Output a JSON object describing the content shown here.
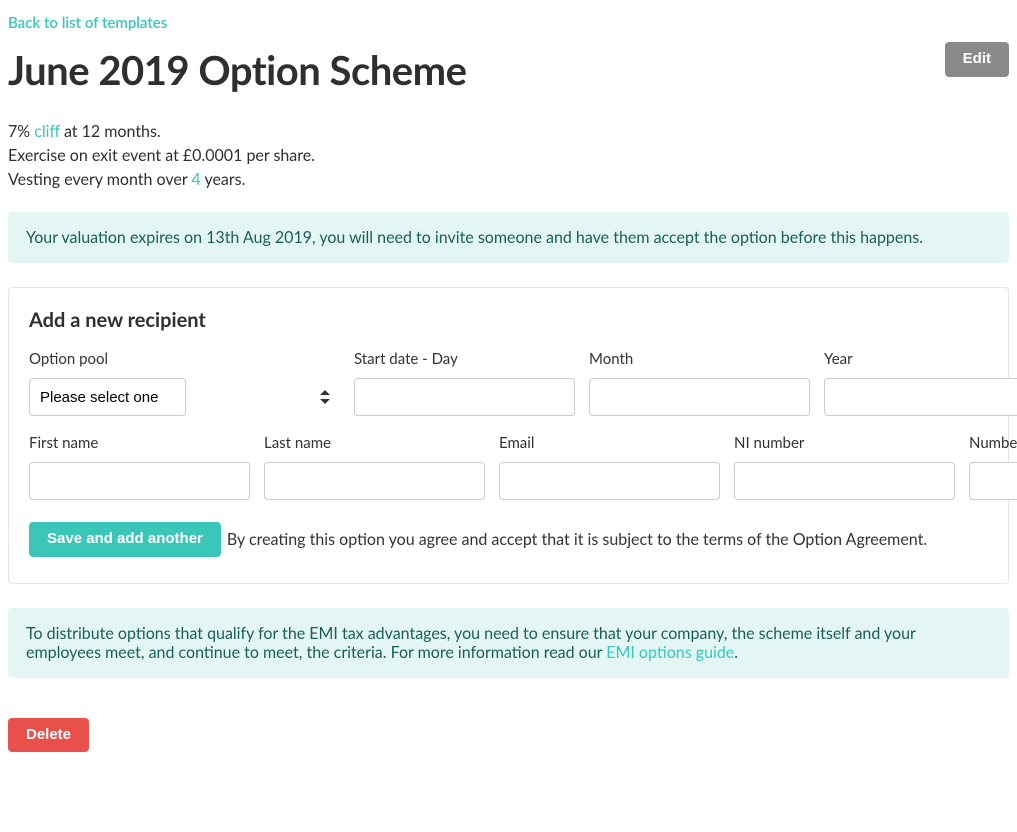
{
  "nav": {
    "back_label": "Back to list of templates"
  },
  "header": {
    "title": "June 2019 Option Scheme",
    "edit_label": "Edit"
  },
  "summary": {
    "cliff_percent": "7%",
    "cliff_term_link": "cliff",
    "cliff_rest": "at 12 months.",
    "exercise_line": "Exercise on exit event at £0.0001 per share.",
    "vesting_prefix": "Vesting every month over",
    "vesting_years_link": "4",
    "vesting_suffix": "years."
  },
  "valuation_alert": {
    "text": "Your valuation expires on 13th Aug 2019, you will need to invite someone and have them accept the option before this happens."
  },
  "form": {
    "panel_title": "Add a new recipient",
    "option_pool_label": "Option pool",
    "option_pool_placeholder": "Please select one",
    "day_label": "Start date - Day",
    "month_label": "Month",
    "year_label": "Year",
    "first_name_label": "First name",
    "last_name_label": "Last name",
    "email_label": "Email",
    "ni_label": "NI number",
    "shares_label": "Number of shares",
    "submit_label": "Save and add another",
    "agree_text": "By creating this option you agree and accept that it is subject to the terms of the Option Agreement."
  },
  "emi_alert": {
    "prefix": "To distribute options that qualify for the EMI tax advantages, you need to ensure that your company, the scheme itself and your employees meet, and continue to meet, the criteria. For more information read our ",
    "link_text": "EMI options guide",
    "suffix": "."
  },
  "footer": {
    "delete_label": "Delete"
  }
}
